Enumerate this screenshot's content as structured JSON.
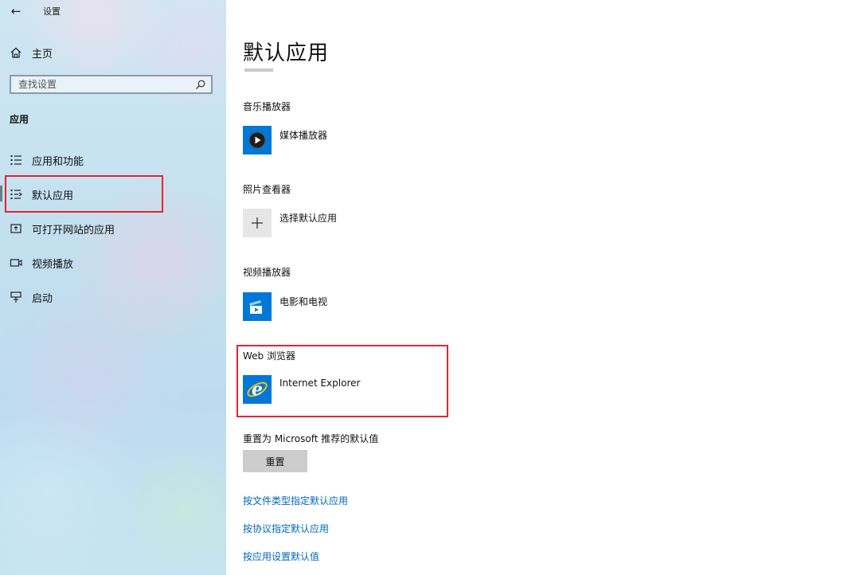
{
  "window": {
    "title": "设置"
  },
  "sidebar": {
    "home_label": "主页",
    "search_placeholder": "查找设置",
    "section": "应用",
    "items": [
      {
        "label": "应用和功能",
        "icon": "list-icon"
      },
      {
        "label": "默认应用",
        "icon": "default-apps-icon",
        "selected": true
      },
      {
        "label": "可打开网站的应用",
        "icon": "open-website-icon"
      },
      {
        "label": "视频播放",
        "icon": "video-icon"
      },
      {
        "label": "启动",
        "icon": "startup-icon"
      }
    ]
  },
  "main": {
    "title": "默认应用",
    "categories": [
      {
        "label": "音乐播放器",
        "app": "媒体播放器",
        "icon": "media-player-icon"
      },
      {
        "label": "照片查看器",
        "app": "选择默认应用",
        "icon": "plus-icon"
      },
      {
        "label": "视频播放器",
        "app": "电影和电视",
        "icon": "movies-tv-icon"
      },
      {
        "label": "Web 浏览器",
        "app": "Internet Explorer",
        "icon": "internet-explorer-icon"
      }
    ],
    "reset": {
      "label": "重置为 Microsoft 推荐的默认值",
      "button": "重置"
    },
    "links": [
      "按文件类型指定默认应用",
      "按协议指定默认应用",
      "按应用设置默认值"
    ]
  },
  "colors": {
    "accent_blue": "#0078d7",
    "link": "#0067c0",
    "highlight_red": "#e0262f"
  }
}
